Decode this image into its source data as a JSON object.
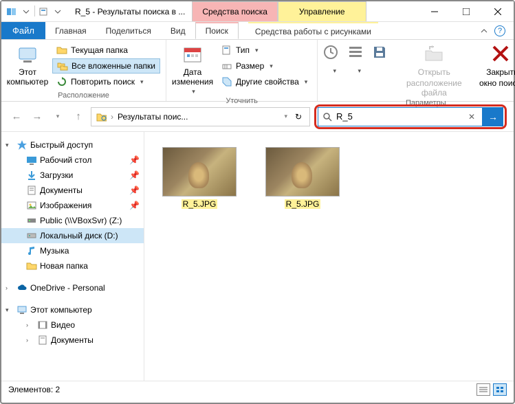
{
  "window": {
    "title": "R_5 - Результаты поиска в ...",
    "context_tools": "Средства поиска",
    "context_manage": "Управление"
  },
  "tabs": {
    "file": "Файл",
    "home": "Главная",
    "share": "Поделиться",
    "view": "Вид",
    "search": "Поиск",
    "pictures": "Средства работы с рисунками"
  },
  "ribbon": {
    "this_pc": "Этот компьютер",
    "current_folder": "Текущая папка",
    "all_subfolders": "Все вложенные папки",
    "search_again": "Повторить поиск",
    "group_location": "Расположение",
    "date_modified": "Дата изменения",
    "type": "Тип",
    "size": "Размер",
    "other_props": "Другие свойства",
    "group_refine": "Уточнить",
    "open_loc_1": "Открыть",
    "open_loc_2": "расположение файла",
    "close_1": "Закрыть",
    "close_2": "окно поиска",
    "group_options": "Параметры"
  },
  "nav": {
    "breadcrumb": "Результаты поис...",
    "search_value": "R_5"
  },
  "sidebar": {
    "quick": "Быстрый доступ",
    "desktop": "Рабочий стол",
    "downloads": "Загрузки",
    "documents": "Документы",
    "pictures": "Изображения",
    "public": "Public (\\\\VBoxSvr) (Z:)",
    "local_disk": "Локальный диск (D:)",
    "music": "Музыка",
    "new_folder": "Новая папка",
    "onedrive": "OneDrive - Personal",
    "this_pc": "Этот компьютер",
    "videos": "Видео",
    "documents2": "Документы"
  },
  "files": [
    {
      "name": "R_5.JPG"
    },
    {
      "name": "R_5.JPG"
    }
  ],
  "status": {
    "items": "Элементов: 2"
  }
}
